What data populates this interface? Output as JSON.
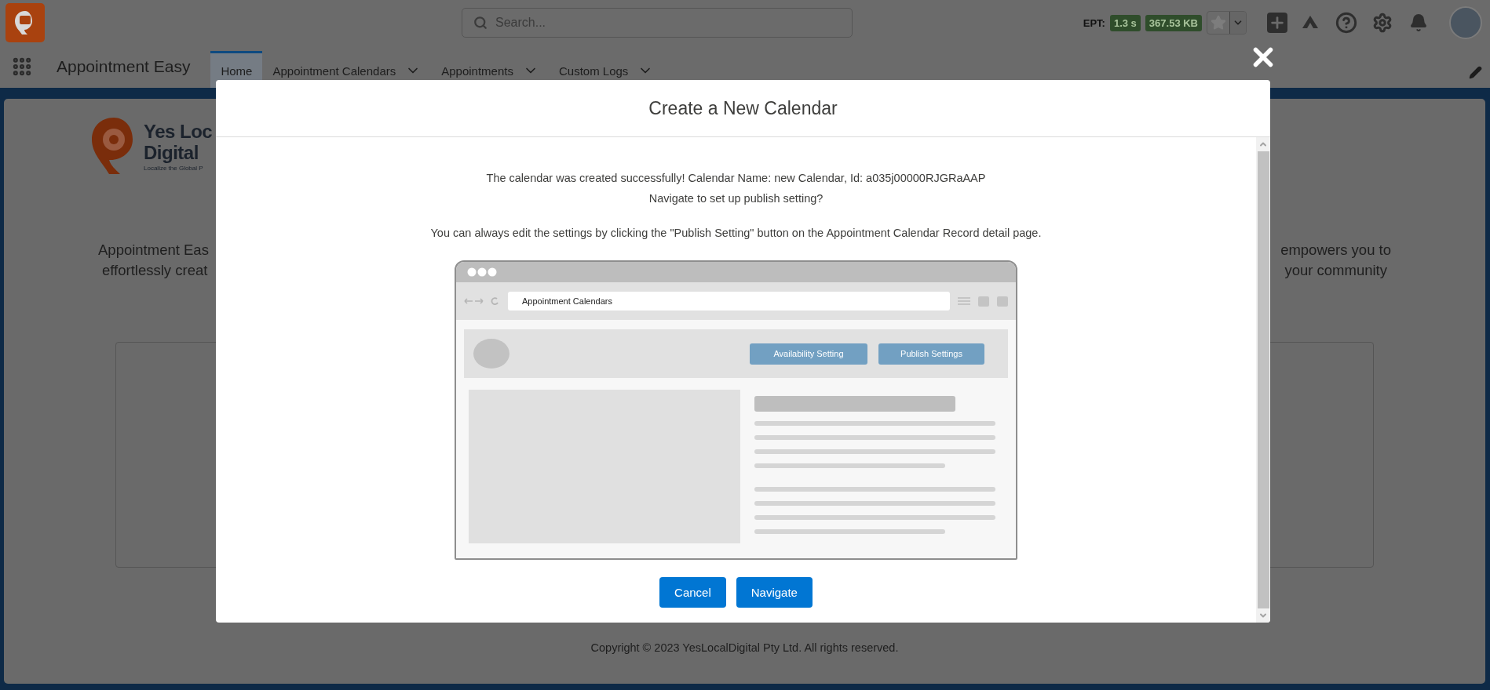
{
  "header": {
    "search": {
      "placeholder": "Search..."
    },
    "ept_label": "EPT:",
    "ept_time": "1.3 s",
    "ept_size": "367.53 KB"
  },
  "nav": {
    "app_name": "Appointment Easy",
    "tabs": [
      {
        "label": "Home",
        "selected": true,
        "has_menu": false
      },
      {
        "label": "Appointment Calendars",
        "selected": false,
        "has_menu": true
      },
      {
        "label": "Appointments",
        "selected": false,
        "has_menu": true
      },
      {
        "label": "Custom Logs",
        "selected": false,
        "has_menu": true
      }
    ]
  },
  "page": {
    "logo": {
      "line_1": "Yes Loc",
      "line_2": "Digital",
      "tagline": "Localize the Global P"
    },
    "intro_left": [
      "Appointment Eas",
      "effortlessly creat"
    ],
    "intro_right": [
      "empowers you to",
      "your community"
    ],
    "footer": "Copyright © 2023 YesLocalDigital Pty Ltd. All rights reserved."
  },
  "modal": {
    "title": "Create a New Calendar",
    "lines": [
      "The calendar was created successfully! Calendar Name: new Calendar, Id: a035j00000RJGRaAAP",
      "Navigate to set up publish setting?"
    ],
    "note": "You can always edit the settings by clicking the \"Publish Setting\" button on the Appointment Calendar Record detail page.",
    "illustration": {
      "address": "Appointment Calendars",
      "buttons": [
        "Availability Setting",
        "Publish Settings"
      ]
    },
    "buttons": [
      {
        "label": "Cancel"
      },
      {
        "label": "Navigate"
      }
    ]
  }
}
